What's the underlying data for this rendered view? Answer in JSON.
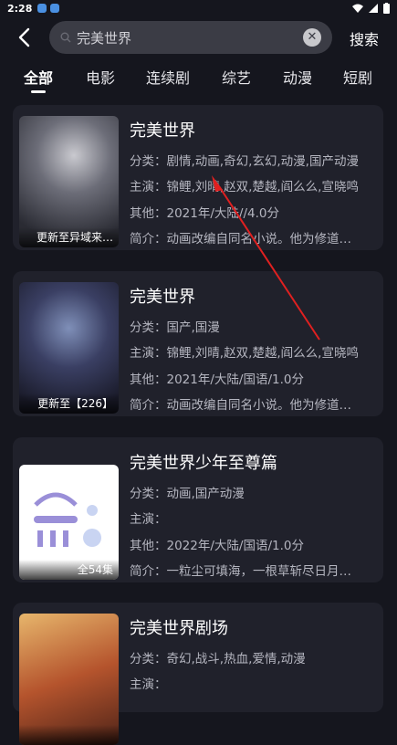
{
  "status_bar": {
    "time": "2:28"
  },
  "search": {
    "query": "完美世界",
    "search_label": "搜索"
  },
  "tabs": [
    {
      "label": "全部",
      "active": true
    },
    {
      "label": "电影"
    },
    {
      "label": "连续剧"
    },
    {
      "label": "综艺"
    },
    {
      "label": "动漫"
    },
    {
      "label": "短剧"
    }
  ],
  "results": [
    {
      "title": "完美世界",
      "badge": "更新至异域来…",
      "genre": "分类：剧情,动画,奇幻,玄幻,动漫,国产动漫",
      "cast": "主演：锦鲤,刘晴,赵双,楚越,阎么么,宣晓鸣",
      "other": "其他：2021年/大陆//4.0分",
      "intro": "简介：动画改编自同名小说。他为修道…"
    },
    {
      "title": "完美世界",
      "badge": "更新至【226】",
      "genre": "分类：国产,国漫",
      "cast": "主演：锦鲤,刘晴,赵双,楚越,阎么么,宣晓鸣",
      "other": "其他：2021年/大陆/国语/1.0分",
      "intro": "简介：动画改编自同名小说。他为修道…"
    },
    {
      "title": "完美世界少年至尊篇",
      "badge": "全54集",
      "genre": "分类：动画,国产动漫",
      "cast": "主演：",
      "other": "其他：2022年/大陆/国语/1.0分",
      "intro": "简介：一粒尘可填海，一根草斩尽日月…"
    },
    {
      "title": "完美世界剧场",
      "badge": "",
      "genre": "分类：奇幻,战斗,热血,爱情,动漫",
      "cast": "主演：",
      "other": "",
      "intro": ""
    }
  ],
  "colors": {
    "background": "#15161e",
    "card": "#20212b",
    "annotation_arrow": "#e02020"
  },
  "icons": [
    "back-arrow-icon",
    "search-icon",
    "clear-icon",
    "wifi-icon",
    "signal-icon",
    "battery-icon"
  ]
}
